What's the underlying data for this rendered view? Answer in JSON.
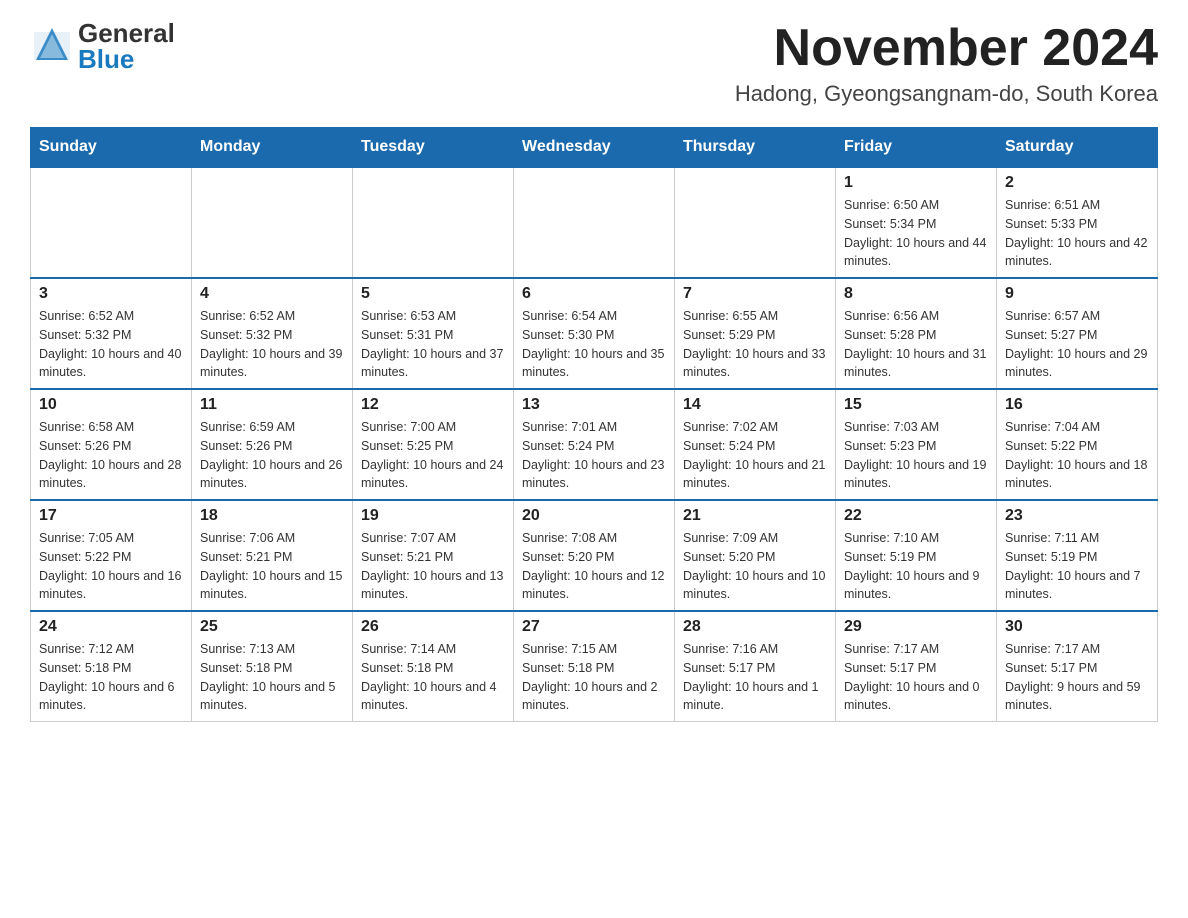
{
  "header": {
    "logo_general": "General",
    "logo_blue": "Blue",
    "title": "November 2024",
    "subtitle": "Hadong, Gyeongsangnam-do, South Korea"
  },
  "calendar": {
    "days_of_week": [
      "Sunday",
      "Monday",
      "Tuesday",
      "Wednesday",
      "Thursday",
      "Friday",
      "Saturday"
    ],
    "weeks": [
      [
        {
          "day": "",
          "info": ""
        },
        {
          "day": "",
          "info": ""
        },
        {
          "day": "",
          "info": ""
        },
        {
          "day": "",
          "info": ""
        },
        {
          "day": "",
          "info": ""
        },
        {
          "day": "1",
          "info": "Sunrise: 6:50 AM\nSunset: 5:34 PM\nDaylight: 10 hours and 44 minutes."
        },
        {
          "day": "2",
          "info": "Sunrise: 6:51 AM\nSunset: 5:33 PM\nDaylight: 10 hours and 42 minutes."
        }
      ],
      [
        {
          "day": "3",
          "info": "Sunrise: 6:52 AM\nSunset: 5:32 PM\nDaylight: 10 hours and 40 minutes."
        },
        {
          "day": "4",
          "info": "Sunrise: 6:52 AM\nSunset: 5:32 PM\nDaylight: 10 hours and 39 minutes."
        },
        {
          "day": "5",
          "info": "Sunrise: 6:53 AM\nSunset: 5:31 PM\nDaylight: 10 hours and 37 minutes."
        },
        {
          "day": "6",
          "info": "Sunrise: 6:54 AM\nSunset: 5:30 PM\nDaylight: 10 hours and 35 minutes."
        },
        {
          "day": "7",
          "info": "Sunrise: 6:55 AM\nSunset: 5:29 PM\nDaylight: 10 hours and 33 minutes."
        },
        {
          "day": "8",
          "info": "Sunrise: 6:56 AM\nSunset: 5:28 PM\nDaylight: 10 hours and 31 minutes."
        },
        {
          "day": "9",
          "info": "Sunrise: 6:57 AM\nSunset: 5:27 PM\nDaylight: 10 hours and 29 minutes."
        }
      ],
      [
        {
          "day": "10",
          "info": "Sunrise: 6:58 AM\nSunset: 5:26 PM\nDaylight: 10 hours and 28 minutes."
        },
        {
          "day": "11",
          "info": "Sunrise: 6:59 AM\nSunset: 5:26 PM\nDaylight: 10 hours and 26 minutes."
        },
        {
          "day": "12",
          "info": "Sunrise: 7:00 AM\nSunset: 5:25 PM\nDaylight: 10 hours and 24 minutes."
        },
        {
          "day": "13",
          "info": "Sunrise: 7:01 AM\nSunset: 5:24 PM\nDaylight: 10 hours and 23 minutes."
        },
        {
          "day": "14",
          "info": "Sunrise: 7:02 AM\nSunset: 5:24 PM\nDaylight: 10 hours and 21 minutes."
        },
        {
          "day": "15",
          "info": "Sunrise: 7:03 AM\nSunset: 5:23 PM\nDaylight: 10 hours and 19 minutes."
        },
        {
          "day": "16",
          "info": "Sunrise: 7:04 AM\nSunset: 5:22 PM\nDaylight: 10 hours and 18 minutes."
        }
      ],
      [
        {
          "day": "17",
          "info": "Sunrise: 7:05 AM\nSunset: 5:22 PM\nDaylight: 10 hours and 16 minutes."
        },
        {
          "day": "18",
          "info": "Sunrise: 7:06 AM\nSunset: 5:21 PM\nDaylight: 10 hours and 15 minutes."
        },
        {
          "day": "19",
          "info": "Sunrise: 7:07 AM\nSunset: 5:21 PM\nDaylight: 10 hours and 13 minutes."
        },
        {
          "day": "20",
          "info": "Sunrise: 7:08 AM\nSunset: 5:20 PM\nDaylight: 10 hours and 12 minutes."
        },
        {
          "day": "21",
          "info": "Sunrise: 7:09 AM\nSunset: 5:20 PM\nDaylight: 10 hours and 10 minutes."
        },
        {
          "day": "22",
          "info": "Sunrise: 7:10 AM\nSunset: 5:19 PM\nDaylight: 10 hours and 9 minutes."
        },
        {
          "day": "23",
          "info": "Sunrise: 7:11 AM\nSunset: 5:19 PM\nDaylight: 10 hours and 7 minutes."
        }
      ],
      [
        {
          "day": "24",
          "info": "Sunrise: 7:12 AM\nSunset: 5:18 PM\nDaylight: 10 hours and 6 minutes."
        },
        {
          "day": "25",
          "info": "Sunrise: 7:13 AM\nSunset: 5:18 PM\nDaylight: 10 hours and 5 minutes."
        },
        {
          "day": "26",
          "info": "Sunrise: 7:14 AM\nSunset: 5:18 PM\nDaylight: 10 hours and 4 minutes."
        },
        {
          "day": "27",
          "info": "Sunrise: 7:15 AM\nSunset: 5:18 PM\nDaylight: 10 hours and 2 minutes."
        },
        {
          "day": "28",
          "info": "Sunrise: 7:16 AM\nSunset: 5:17 PM\nDaylight: 10 hours and 1 minute."
        },
        {
          "day": "29",
          "info": "Sunrise: 7:17 AM\nSunset: 5:17 PM\nDaylight: 10 hours and 0 minutes."
        },
        {
          "day": "30",
          "info": "Sunrise: 7:17 AM\nSunset: 5:17 PM\nDaylight: 9 hours and 59 minutes."
        }
      ]
    ]
  }
}
